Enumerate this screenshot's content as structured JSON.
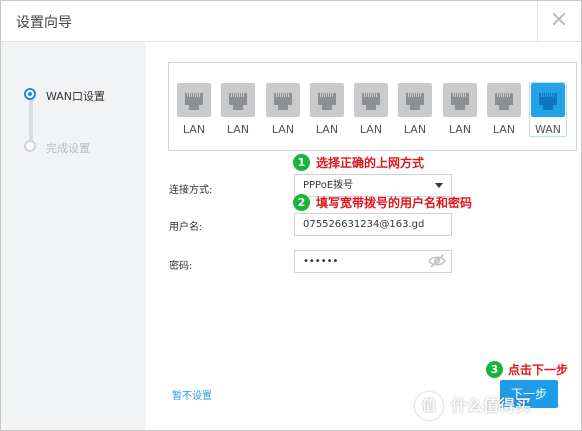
{
  "dialog": {
    "title": "设置向导",
    "close_label": "×"
  },
  "steps": [
    {
      "label": "WAN口设置",
      "active": true
    },
    {
      "label": "完成设置",
      "active": false
    }
  ],
  "ports": [
    {
      "label": "LAN"
    },
    {
      "label": "LAN"
    },
    {
      "label": "LAN"
    },
    {
      "label": "LAN"
    },
    {
      "label": "LAN"
    },
    {
      "label": "LAN"
    },
    {
      "label": "LAN"
    },
    {
      "label": "LAN"
    },
    {
      "label": "WAN"
    }
  ],
  "form": {
    "connection_label": "连接方式:",
    "connection_value": "PPPoE拨号",
    "username_label": "用户名:",
    "username_value": "075526631234@163.gd",
    "password_label": "密码:",
    "password_value": "••••••"
  },
  "annotations": [
    {
      "number": "1",
      "text": "选择正确的上网方式"
    },
    {
      "number": "2",
      "text": "填写宽带拨号的用户名和密码"
    },
    {
      "number": "3",
      "text": "点击下一步"
    }
  ],
  "footer": {
    "skip_label": "暂不设置",
    "next_label": "下一步"
  },
  "watermark": {
    "icon_char": "值",
    "text": "什么值得买"
  },
  "colors": {
    "accent": "#1e9be9",
    "annotation": "#e3141b",
    "badge": "#19b43a"
  }
}
